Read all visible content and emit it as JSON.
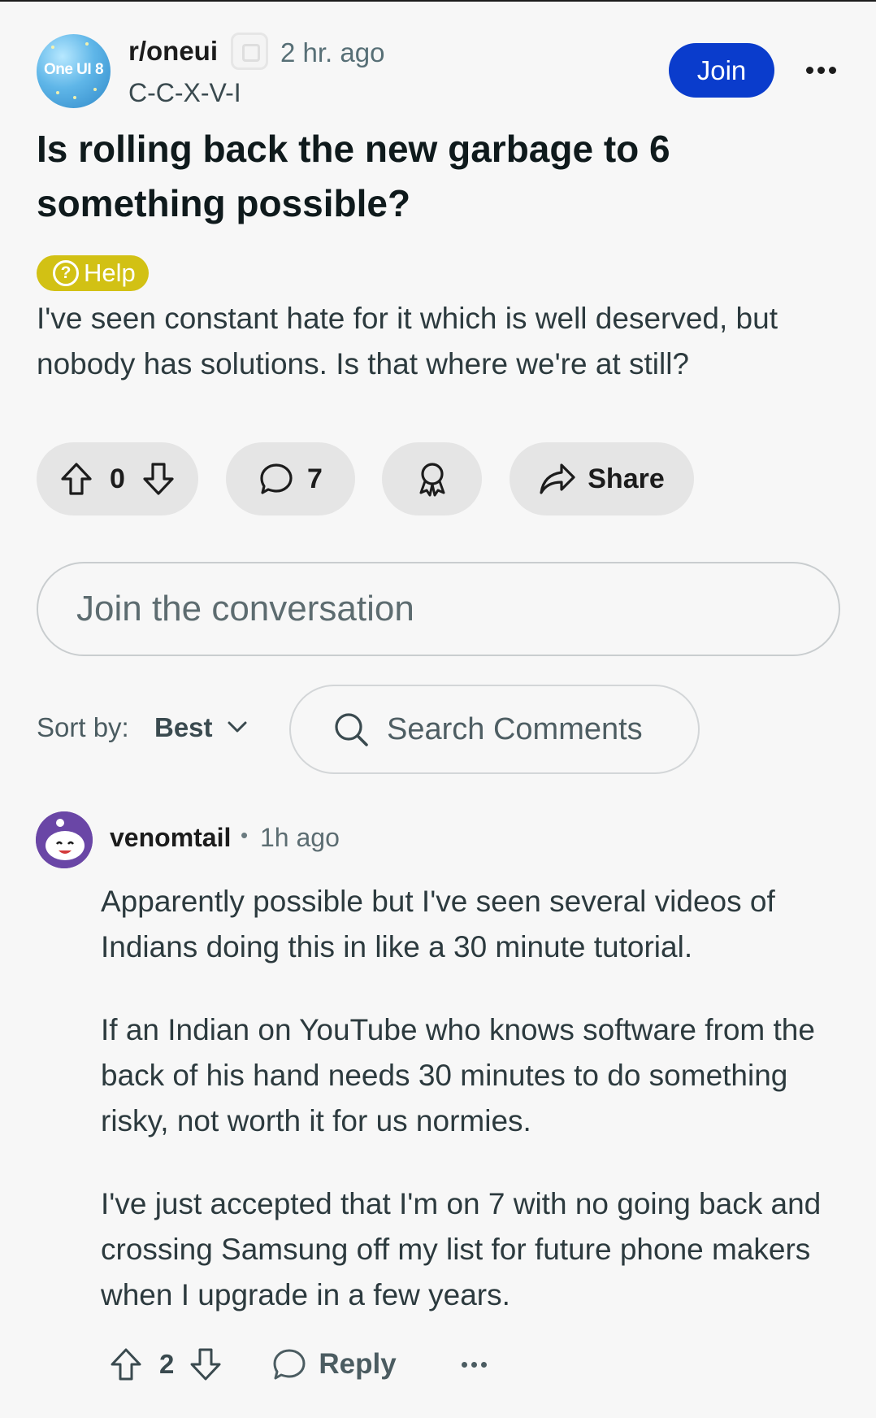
{
  "post": {
    "subreddit": "r/oneui",
    "subreddit_avatar_text": "One UI 8",
    "time_ago": "2 hr. ago",
    "author": "C-C-X-V-I",
    "join_label": "Join",
    "title": "Is rolling back the new garbage to 6 something possible?",
    "flair_icon": "?",
    "flair": "Help",
    "flair_color": "#d2c114",
    "body": "I've seen constant hate for it which is well deserved, but nobody has solutions. Is that where we're at still?",
    "votes": "0",
    "comments": "7",
    "share_label": "Share"
  },
  "composer": {
    "placeholder": "Join the conversation"
  },
  "sort": {
    "label": "Sort by:",
    "value": "Best",
    "search_placeholder": "Search Comments"
  },
  "comment": {
    "username": "venomtail",
    "separator": "•",
    "time_ago": "1h ago",
    "paragraphs": [
      "Apparently possible but I've seen several videos of Indians doing this in like a 30 minute tutorial.",
      "If an Indian on YouTube who knows software from the back of his hand needs 30 minutes to do something risky, not worth it for us normies.",
      "I've just accepted that I'm on 7 with no going back and crossing Samsung off my list for future phone makers when I upgrade in a few years."
    ],
    "score": "2",
    "reply_label": "Reply"
  },
  "colors": {
    "join_button": "#0a3ccc",
    "background": "#f7f7f7",
    "pill": "#e5e5e5"
  },
  "icons": [
    "overflow-menu-icon",
    "question-circle-icon",
    "upvote-icon",
    "downvote-icon",
    "comment-bubble-icon",
    "award-icon",
    "share-arrow-icon",
    "search-icon",
    "chevron-down-icon",
    "snoo-avatar-icon",
    "mod-badge-icon"
  ]
}
